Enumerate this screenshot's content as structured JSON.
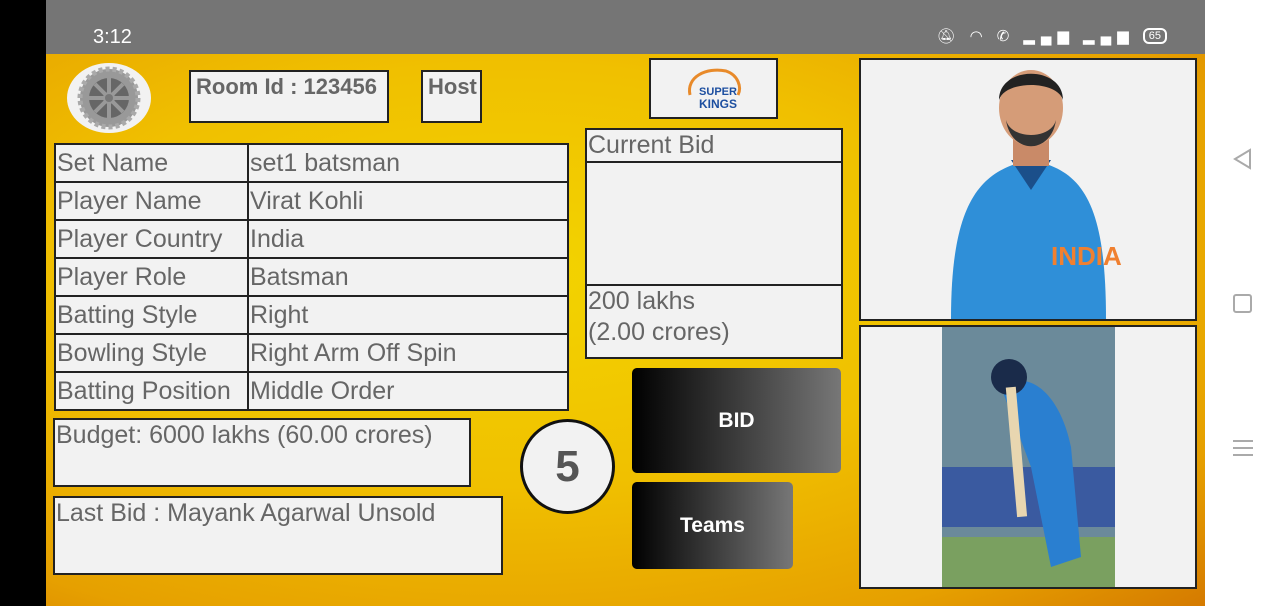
{
  "status_bar": {
    "time": "3:12",
    "battery": "65",
    "icons": [
      "bell-off-icon",
      "wifi-icon",
      "wifi-calling-icon",
      "signal-icon",
      "signal-icon",
      "battery-icon"
    ]
  },
  "header": {
    "room_id": "Room Id : 123456",
    "host": "Host",
    "team_logo_text": "SUPER KINGS"
  },
  "player_table": [
    {
      "label": "Set Name",
      "value": "set1 batsman"
    },
    {
      "label": "Player Name",
      "value": "Virat Kohli"
    },
    {
      "label": "Player Country",
      "value": "India"
    },
    {
      "label": "Player Role",
      "value": "Batsman"
    },
    {
      "label": "Batting Style",
      "value": "Right"
    },
    {
      "label": "Bowling Style",
      "value": "Right Arm Off Spin"
    },
    {
      "label": "Batting Position",
      "value": "Middle Order"
    }
  ],
  "budget": "Budget: 6000 lakhs (60.00 crores)",
  "last_bid": "Last Bid : Mayank Agarwal Unsold",
  "timer": "5",
  "current_bid": {
    "label": "Current Bid",
    "bidder": "",
    "amount_lakhs": "200 lakhs",
    "amount_crores": "(2.00 crores)"
  },
  "buttons": {
    "bid": "BID",
    "teams": "Teams"
  },
  "colors": {
    "bg": "#f0c000",
    "status": "#757575"
  }
}
